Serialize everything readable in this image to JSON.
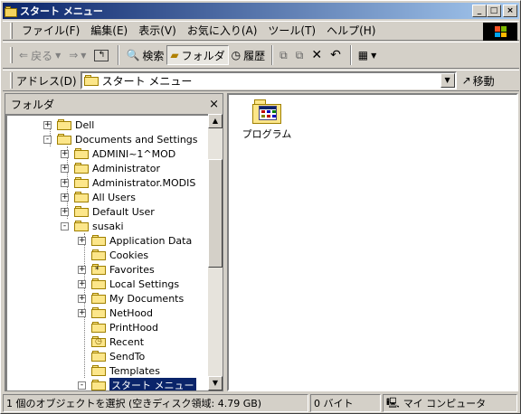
{
  "window": {
    "title": "スタート メニュー",
    "buttons": {
      "minimize": "_",
      "maximize": "□",
      "close": "×"
    }
  },
  "menu": [
    "ファイル(F)",
    "編集(E)",
    "表示(V)",
    "お気に入り(A)",
    "ツール(T)",
    "ヘルプ(H)"
  ],
  "toolbar": {
    "back": "戻る",
    "search": "検索",
    "folders": "フォルダ",
    "history": "履歴"
  },
  "address": {
    "label": "アドレス(D)",
    "value": "スタート メニュー",
    "go": "移動"
  },
  "folders_pane": {
    "title": "フォルダ",
    "close": "×",
    "tree": [
      {
        "label": "Dell",
        "level": 2,
        "expander": "+"
      },
      {
        "label": "Documents and Settings",
        "level": 2,
        "expander": "-"
      },
      {
        "label": "ADMINI~1^MOD",
        "level": 3,
        "expander": "+"
      },
      {
        "label": "Administrator",
        "level": 3,
        "expander": "+"
      },
      {
        "label": "Administrator.MODIS",
        "level": 3,
        "expander": "+"
      },
      {
        "label": "All Users",
        "level": 3,
        "expander": "+"
      },
      {
        "label": "Default User",
        "level": 3,
        "expander": "+"
      },
      {
        "label": "susaki",
        "level": 3,
        "expander": "-"
      },
      {
        "label": "Application Data",
        "level": 4,
        "expander": "+"
      },
      {
        "label": "Cookies",
        "level": 4,
        "expander": ""
      },
      {
        "label": "Favorites",
        "level": 4,
        "expander": "+",
        "icon": "favorites"
      },
      {
        "label": "Local Settings",
        "level": 4,
        "expander": "+"
      },
      {
        "label": "My Documents",
        "level": 4,
        "expander": "+"
      },
      {
        "label": "NetHood",
        "level": 4,
        "expander": "+"
      },
      {
        "label": "PrintHood",
        "level": 4,
        "expander": ""
      },
      {
        "label": "Recent",
        "level": 4,
        "expander": "",
        "icon": "recent"
      },
      {
        "label": "SendTo",
        "level": 4,
        "expander": ""
      },
      {
        "label": "Templates",
        "level": 4,
        "expander": ""
      },
      {
        "label": "スタート メニュー",
        "level": 4,
        "expander": "-",
        "selected": true
      }
    ]
  },
  "content": {
    "items": [
      {
        "label": "プログラム",
        "icon": "program-folder-icon"
      }
    ]
  },
  "status": {
    "selection": "1 個のオブジェクトを選択 (空きディスク領域: 4.79 GB)",
    "size": "0 バイト",
    "location": "マイ コンピュータ"
  }
}
